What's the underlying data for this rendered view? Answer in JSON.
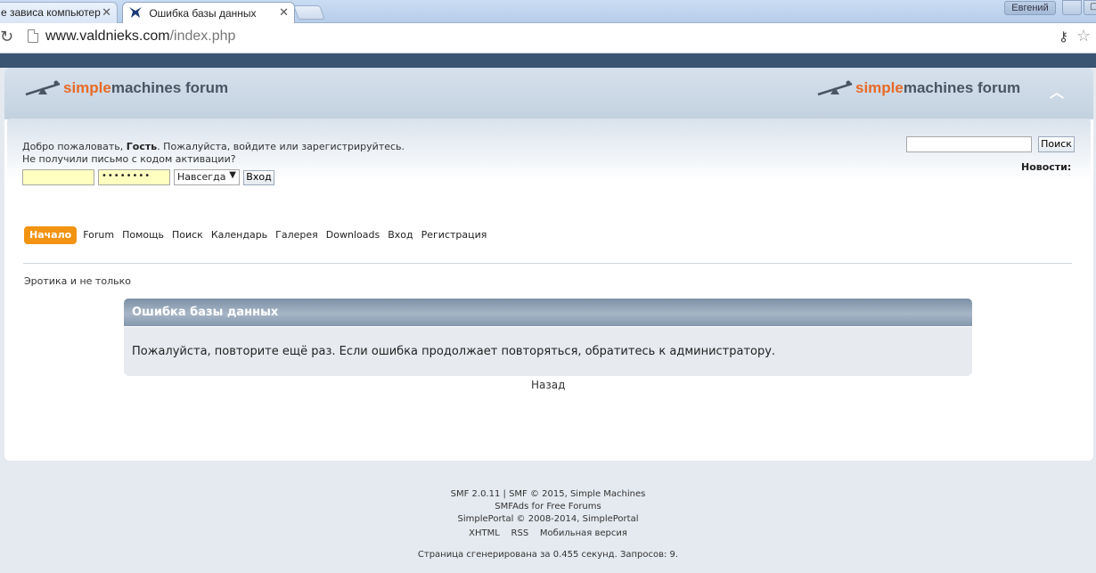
{
  "browser": {
    "tabs": [
      {
        "title": "е зависа компьютер"
      },
      {
        "title": "Ошибка базы данных"
      }
    ],
    "user_name": "Евгений",
    "url_host": "www.valdnieks.com",
    "url_path": "/index.php"
  },
  "header": {
    "logo_simple": "simple",
    "logo_rest": "machines forum"
  },
  "userbar": {
    "welcome_prefix": "Добро пожаловать, ",
    "guest": "Гость",
    "welcome_suffix": ". Пожалуйста, войдите или зарегистрируйтесь.",
    "activation": "Не получили письмо с кодом активации?",
    "password_mask": "••••••••",
    "duration": "Навсегда",
    "login_button": "Вход",
    "search_button": "Поиск",
    "news_label": "Новости:"
  },
  "menu": {
    "items": [
      "Начало",
      "Forum",
      "Помощь",
      "Поиск",
      "Календарь",
      "Галерея",
      "Downloads",
      "Вход",
      "Регистрация"
    ]
  },
  "linktree": "Эротика и не только",
  "error": {
    "title": "Ошибка базы данных",
    "message": "Пожалуйста, повторите ещё раз. Если ошибка продолжает повторяться, обратитесь к администратору.",
    "back": "Назад"
  },
  "footer": {
    "line1": "SMF 2.0.11 | SMF © 2015, Simple Machines",
    "line2": "SMFAds for Free Forums",
    "line3": "SimplePortal © 2008-2014, SimplePortal",
    "links": [
      "XHTML",
      "RSS",
      "Мобильная версия"
    ],
    "generated": "Страница сгенерирована за 0.455 секунд. Запросов: 9."
  },
  "colors": {
    "menu_active": "#f29412",
    "logo_accent": "#e86a24",
    "top_band": "#3a5572"
  }
}
